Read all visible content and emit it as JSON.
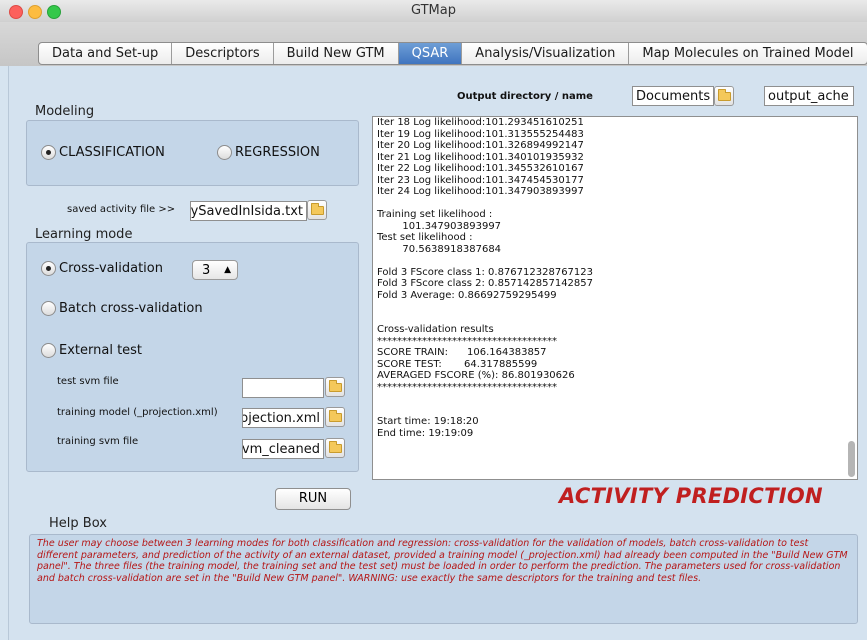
{
  "window": {
    "title": "GTMap"
  },
  "tabs": [
    {
      "label": "Data and Set-up"
    },
    {
      "label": "Descriptors"
    },
    {
      "label": "Build New GTM"
    },
    {
      "label": "QSAR"
    },
    {
      "label": "Analysis/Visualization"
    },
    {
      "label": "Map Molecules on Trained Model"
    }
  ],
  "output_dir": {
    "label": "Output directory / name",
    "directory": "Documents",
    "name": "output_ache"
  },
  "modeling": {
    "title": "Modeling",
    "classification_label": "CLASSIFICATION",
    "regression_label": "REGRESSION",
    "selected": "CLASSIFICATION"
  },
  "saved_activity": {
    "label": "saved activity file >>",
    "value": "ySavedInIsida.txt"
  },
  "learning_mode": {
    "title": "Learning mode",
    "cross_validation_label": "Cross-validation",
    "folds_value": "3",
    "batch_label": "Batch cross-validation",
    "external_label": "External test",
    "selected": "Cross-validation",
    "test_svm_label": "test svm file",
    "test_svm_value": "",
    "training_model_label": "training model (_projection.xml)",
    "training_model_value": "ojection.xml",
    "training_svm_label": "training svm file",
    "training_svm_value": "vm_cleaned"
  },
  "output_log": "Iter 18 Log likelihood:101.293451610251\nIter 19 Log likelihood:101.313555254483\nIter 20 Log likelihood:101.326894992147\nIter 21 Log likelihood:101.340101935932\nIter 22 Log likelihood:101.345532610167\nIter 23 Log likelihood:101.347454530177\nIter 24 Log likelihood:101.347903893997\n\nTraining set likelihood :\n        101.347903893997\nTest set likelihood :\n        70.5638918387684\n\nFold 3 FScore class 1: 0.876712328767123\nFold 3 FScore class 2: 0.857142857142857\nFold 3 Average: 0.86692759295499\n\n\nCross-validation results\n************************************\nSCORE TRAIN:      106.164383857\nSCORE TEST:       64.317885599\nAVERAGED FSCORE (%): 86.801930626\n************************************\n\n\nStart time: 19:18:20\nEnd time: 19:19:09",
  "run_button": "RUN",
  "banner": "ACTIVITY PREDICTION",
  "help": {
    "title": "Help Box",
    "text": "The user may choose between 3 learning modes for both classification and regression: cross-validation for the validation of models, batch cross-validation to test different parameters, and prediction of the activity of an external dataset, provided a training model (_projection.xml) had already been computed in the \"Build New GTM panel\". The three files (the training model, the training set and the test set) must be loaded in order to perform the prediction. The parameters used for cross-validation and batch cross-validation are set in the \"Build New GTM panel\". WARNING: use exactly the same descriptors for the training and test files."
  },
  "colors": {
    "banner": "#c01f1f",
    "help_text": "#b51616",
    "active_tab": "#3f74bf",
    "panel_bg": "#d4e2ef"
  }
}
